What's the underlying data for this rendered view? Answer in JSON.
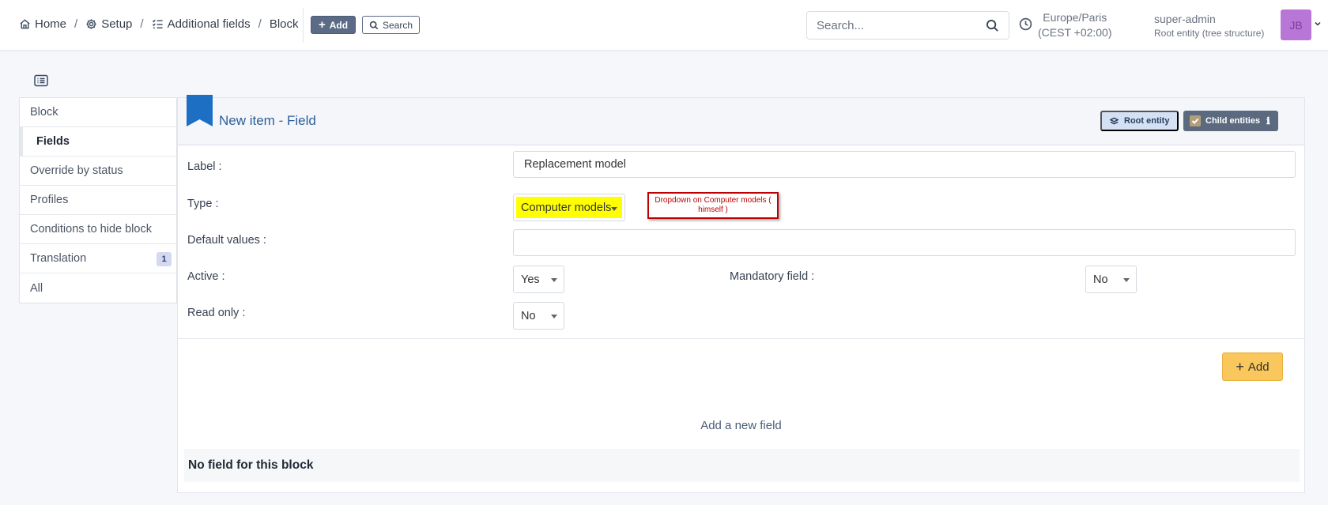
{
  "breadcrumb": {
    "home": "Home",
    "setup": "Setup",
    "additional_fields": "Additional fields",
    "block": "Block",
    "separator": "/"
  },
  "toolbar": {
    "add_label": "Add",
    "search_label": "Search"
  },
  "global_search": {
    "placeholder": "Search..."
  },
  "timezone": {
    "line1": "Europe/Paris",
    "line2": "(CEST +02:00)"
  },
  "user": {
    "name": "super-admin",
    "entity": "Root entity (tree structure)",
    "initials": "JB"
  },
  "sidebar": {
    "items": [
      {
        "label": "Block"
      },
      {
        "label": "Fields",
        "active": true
      },
      {
        "label": "Override by status"
      },
      {
        "label": "Profiles"
      },
      {
        "label": "Conditions to hide block"
      },
      {
        "label": "Translation",
        "badge": "1"
      },
      {
        "label": "All"
      }
    ]
  },
  "form": {
    "title": "New item - Field",
    "root_entity_label": "Root entity",
    "child_entities_label": "Child entities",
    "label_label": "Label :",
    "label_value": "Replacement model",
    "type_label": "Type :",
    "type_value": "Computer models",
    "annotation": "Dropdown on Computer models ( himself )",
    "default_values_label": "Default values :",
    "default_values_value": "",
    "active_label": "Active :",
    "active_value": "Yes",
    "mandatory_label": "Mandatory field :",
    "mandatory_value": "No",
    "readonly_label": "Read only :",
    "readonly_value": "No",
    "add_button": "Add",
    "add_new_field": "Add a new field",
    "empty_message": "No field for this block"
  },
  "colors": {
    "accent_blue": "#1d6fc4",
    "highlight_yellow": "#ffff00",
    "annotation_red": "#c00000",
    "add_button": "#f9c75b",
    "avatar": "#b877d6"
  }
}
